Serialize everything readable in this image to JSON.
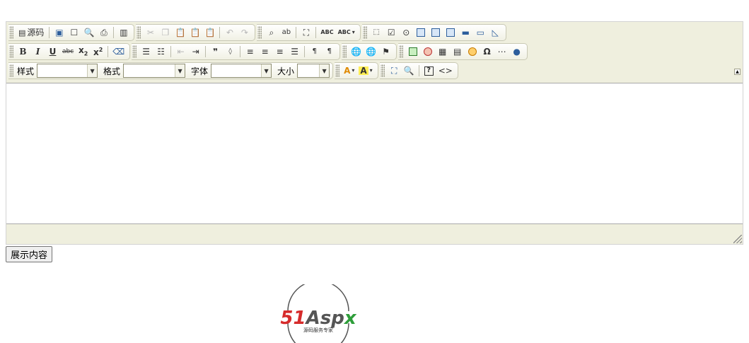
{
  "toolbar": {
    "source_label": "源码",
    "style_label": "样式",
    "format_label": "格式",
    "font_label": "字体",
    "size_label": "大小"
  },
  "form": {
    "show_content_label": "展示内容"
  },
  "logo": {
    "brand_text": "51Aspx",
    "tagline": "源码服务专家",
    "brand_red": "#d62b2b",
    "brand_gray": "#555555",
    "brand_green": "#2e9e3a"
  }
}
